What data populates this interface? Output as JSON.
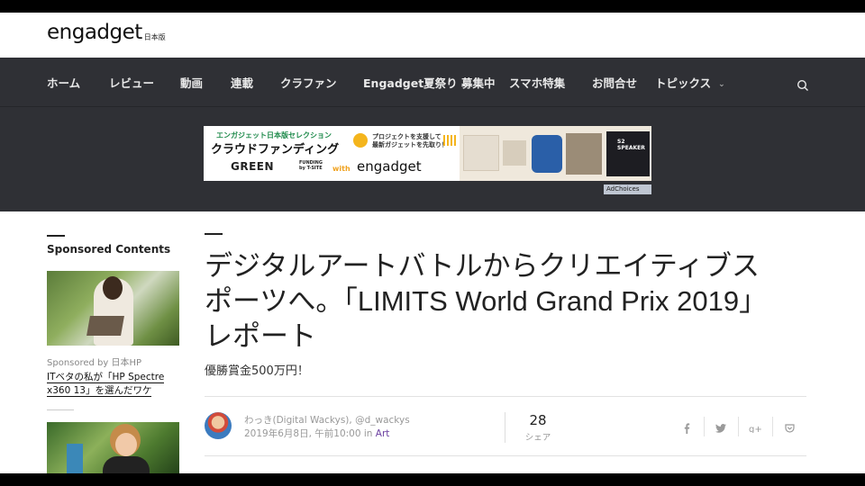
{
  "brand": {
    "logo": "engadget",
    "logo_sub": "日本版"
  },
  "nav": {
    "items": [
      "ホーム",
      "レビュー",
      "動画",
      "連載",
      "クラファン",
      "Engadget夏祭り 募集中",
      "スマホ特集",
      "お問合せ",
      "トピックス"
    ]
  },
  "ad": {
    "line1": "エンガジェット日本版セレクション",
    "line2": "クラウドファンディング",
    "catch": "プロジェクトを支援して\n最新ガジェットを先取り！",
    "green": "GREEN",
    "funding": "FUNDING\nby T-SITE",
    "with": "with",
    "engadget": "engadget",
    "speaker_label": "S2 SPEAKER",
    "adchoices": "AdChoices"
  },
  "sidebar": {
    "title": "Sponsored Contents",
    "item1": {
      "sponsor": "Sponsored by 日本HP",
      "link": "ITベタの私が「HP Spectre x360 13」を選んだワケ"
    }
  },
  "article": {
    "title": "デジタルアートバトルからクリエイティブスポーツへ。「LIMITS World Grand Prix 2019」レポート",
    "subtitle": "優勝賞金500万円！",
    "author": "わっき(Digital Wackys), @d_wackys",
    "date": "2019年6月8日, 午前10:00 in ",
    "category": "Art",
    "share_count": "28",
    "share_label": "シェア"
  },
  "icons": {
    "search": "search-icon",
    "facebook": "facebook-icon",
    "twitter": "twitter-icon",
    "gplus": "google-plus-icon",
    "pocket": "pocket-icon"
  }
}
